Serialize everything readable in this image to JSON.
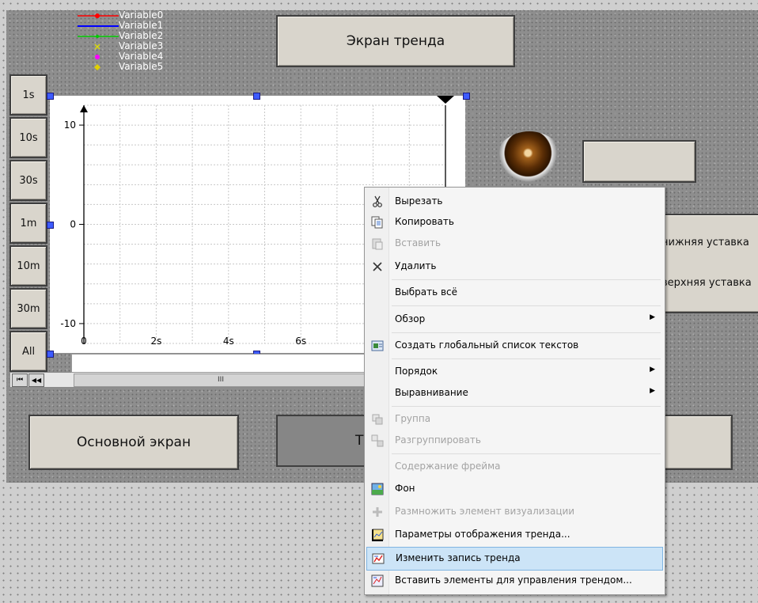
{
  "title_button": "Экран тренда",
  "legend": [
    {
      "name": "Variable0",
      "color": "#ff0000",
      "marker": "dot"
    },
    {
      "name": "Variable1",
      "color": "#0000ff",
      "marker": "line"
    },
    {
      "name": "Variable2",
      "color": "#00cc00",
      "marker": "dot"
    },
    {
      "name": "Variable3",
      "color": "#dddd00",
      "marker": "x"
    },
    {
      "name": "Variable4",
      "color": "#ff00ff",
      "marker": "dot"
    },
    {
      "name": "Variable5",
      "color": "#e0d000",
      "marker": "diamond"
    }
  ],
  "time_buttons": [
    "1s",
    "10s",
    "30s",
    "1m",
    "10m",
    "30m",
    "All"
  ],
  "chart_data": {
    "type": "line",
    "series": [],
    "y_ticks": [
      10,
      0,
      -10
    ],
    "x_ticks": [
      "0",
      "2s",
      "4s",
      "6s"
    ],
    "ylim": [
      -12,
      12
    ],
    "xlim": [
      0,
      10
    ],
    "grid": true
  },
  "scroll_controls": {
    "first": "⏮",
    "prev": "◀◀",
    "thumb": "III"
  },
  "buttons": {
    "main_screen": "Основной экран",
    "trend_partial": "Т",
    "lower_setpoint": "нижняя уставка",
    "upper_setpoint": "верхняя уставка"
  },
  "context_menu": [
    {
      "label": "Вырезать",
      "enabled": true,
      "icon": "cut-icon"
    },
    {
      "label": "Копировать",
      "enabled": true,
      "icon": "copy-icon"
    },
    {
      "label": "Вставить",
      "enabled": false,
      "icon": "paste-icon"
    },
    {
      "label": "Удалить",
      "enabled": true,
      "icon": "delete-icon"
    },
    {
      "label": "Выбрать всё",
      "enabled": true,
      "icon": ""
    },
    {
      "label": "Обзор",
      "enabled": true,
      "icon": "",
      "submenu": true
    },
    {
      "label": "Создать глобальный список текстов",
      "enabled": true,
      "icon": "text-list-icon"
    },
    {
      "label": "Порядок",
      "enabled": true,
      "icon": "",
      "submenu": true
    },
    {
      "label": "Выравнивание",
      "enabled": true,
      "icon": "",
      "submenu": true
    },
    {
      "label": "Группа",
      "enabled": false,
      "icon": "group-icon"
    },
    {
      "label": "Разгруппировать",
      "enabled": false,
      "icon": "ungroup-icon"
    },
    {
      "label": "Содержание фрейма",
      "enabled": false,
      "icon": ""
    },
    {
      "label": "Фон",
      "enabled": true,
      "icon": "background-icon"
    },
    {
      "label": "Размножить элемент визуализации",
      "enabled": false,
      "icon": "multiply-icon"
    },
    {
      "label": "Параметры отображения тренда...",
      "enabled": true,
      "icon": "trend-params-icon"
    },
    {
      "label": "Изменить запись тренда",
      "enabled": true,
      "icon": "trend-record-icon",
      "highlighted": true
    },
    {
      "label": "Вставить элементы для управления трендом...",
      "enabled": true,
      "icon": "trend-controls-icon"
    }
  ]
}
